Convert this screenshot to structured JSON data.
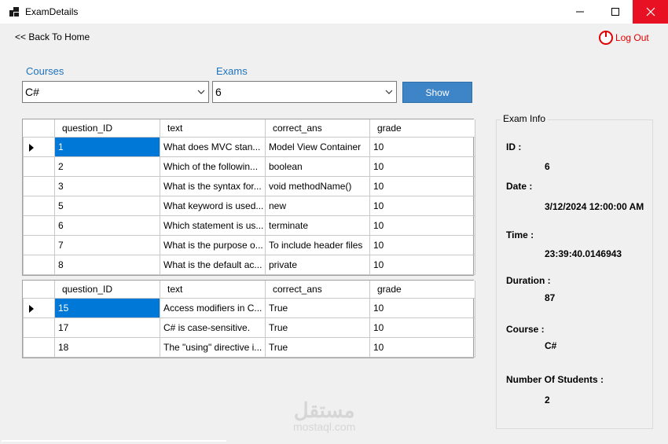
{
  "window": {
    "title": "ExamDetails",
    "minimize_glyph": "—",
    "maximize_glyph": "☐",
    "close_glyph": "✕"
  },
  "nav": {
    "back_label": "<< Back To Home",
    "logout_label": "Log Out",
    "logout_icon": "power-icon"
  },
  "filters": {
    "courses_label": "Courses",
    "courses_value": "C#",
    "exams_label": "Exams",
    "exams_value": "6",
    "show_label": "Show"
  },
  "mcq_table": {
    "columns": [
      "question_ID",
      "text",
      "correct_ans",
      "grade"
    ],
    "rows": [
      [
        "1",
        "What does MVC stan...",
        "Model View Container",
        "10"
      ],
      [
        "2",
        "Which of the followin...",
        "boolean",
        "10"
      ],
      [
        "3",
        "What is the syntax for...",
        "void methodName()",
        "10"
      ],
      [
        "5",
        "What keyword is used...",
        "new",
        "10"
      ],
      [
        "6",
        "Which statement is us...",
        "terminate",
        "10"
      ],
      [
        "7",
        "What is the purpose o...",
        "To include header files",
        "10"
      ],
      [
        "8",
        "What is the default ac...",
        "private",
        "10"
      ]
    ]
  },
  "tf_table": {
    "columns": [
      "question_ID",
      "text",
      "correct_ans",
      "grade"
    ],
    "rows": [
      [
        "15",
        "Access modifiers in C...",
        "True",
        "10"
      ],
      [
        "17",
        "C# is case-sensitive.",
        "True",
        "10"
      ],
      [
        "18",
        "The \"using\" directive i...",
        "True",
        "10"
      ]
    ]
  },
  "exam_info": {
    "title": "Exam Info",
    "id_label": "ID :",
    "id_value": "6",
    "date_label": "Date :",
    "date_value": "3/12/2024 12:00:00 AM",
    "time_label": "Time :",
    "time_value": "23:39:40.0146943",
    "duration_label": "Duration :",
    "duration_value": "87",
    "course_label": "Course :",
    "course_value": "C#",
    "students_label": "Number Of Students :",
    "students_value": "2"
  },
  "watermark": {
    "arabic": "مستقل",
    "latin": "mostaql.com"
  },
  "colors": {
    "accent": "#1e73be",
    "button": "#3d85c6",
    "selection": "#0078d7",
    "close": "#e81123",
    "logout": "#e00000"
  }
}
